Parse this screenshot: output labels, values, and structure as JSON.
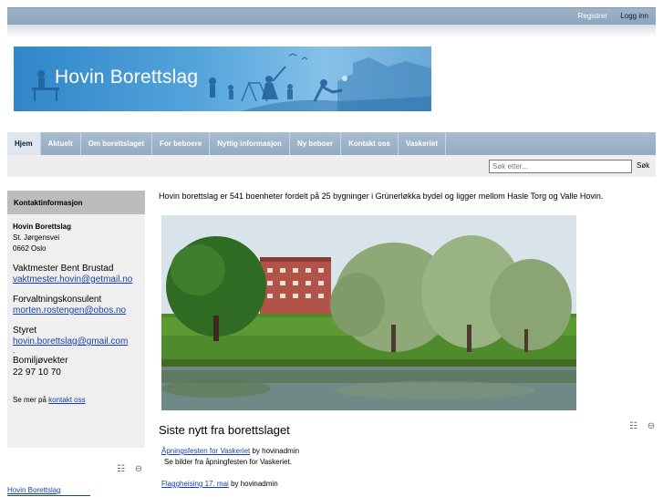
{
  "header": {
    "register": "Registrer",
    "login": "Logg inn"
  },
  "banner": {
    "title": "Hovin Borettslag"
  },
  "nav": {
    "items": [
      {
        "label": "Hjem"
      },
      {
        "label": "Aktuelt"
      },
      {
        "label": "Om borettslaget"
      },
      {
        "label": "For beboere"
      },
      {
        "label": "Nyttig informasjon"
      },
      {
        "label": "Ny beboer"
      },
      {
        "label": "Kontakt oss"
      },
      {
        "label": "Vaskeriet"
      }
    ]
  },
  "search": {
    "placeholder": "Søk etter...",
    "button": "Søk"
  },
  "sidebar": {
    "heading": "Kontaktinformasjon",
    "name": "Hovin Borettslag",
    "street": "St. Jørgensvei",
    "postal": "0662 Oslo",
    "caretaker_label": "Vaktmester Bent Brustad",
    "caretaker_email": "vaktmester.hovin@getmail.no",
    "manager_label": "Forvaltningskonsulent",
    "manager_email": "morten.rostengen@obos.no",
    "board_label": "Styret",
    "board_email": "hovin.borettslag@gmail.com",
    "dot": ".",
    "guard_label": "Bomiljøvekter",
    "guard_phone": "22 97 10 70",
    "see_more": "Se mer på",
    "contact_link": "kontakt oss",
    "footer_link": "Hovin Borettslag"
  },
  "main": {
    "intro": "Hovin borettslag er 541 boenheter fordelt på 25 bygninger i Grünerløkka bydel og ligger mellom Hasle Torg og Valle Hovin.",
    "news_title": "Siste nytt fra borettslaget",
    "news": [
      {
        "title": "Åpningsfesten for Vaskeriet",
        "by": "by hovinadmin",
        "desc": "Se bilder fra åpningfesten for Vaskeriet."
      },
      {
        "title": "Flaggheising 17. mai",
        "by": "by hovinadmin",
        "desc": ""
      }
    ]
  }
}
